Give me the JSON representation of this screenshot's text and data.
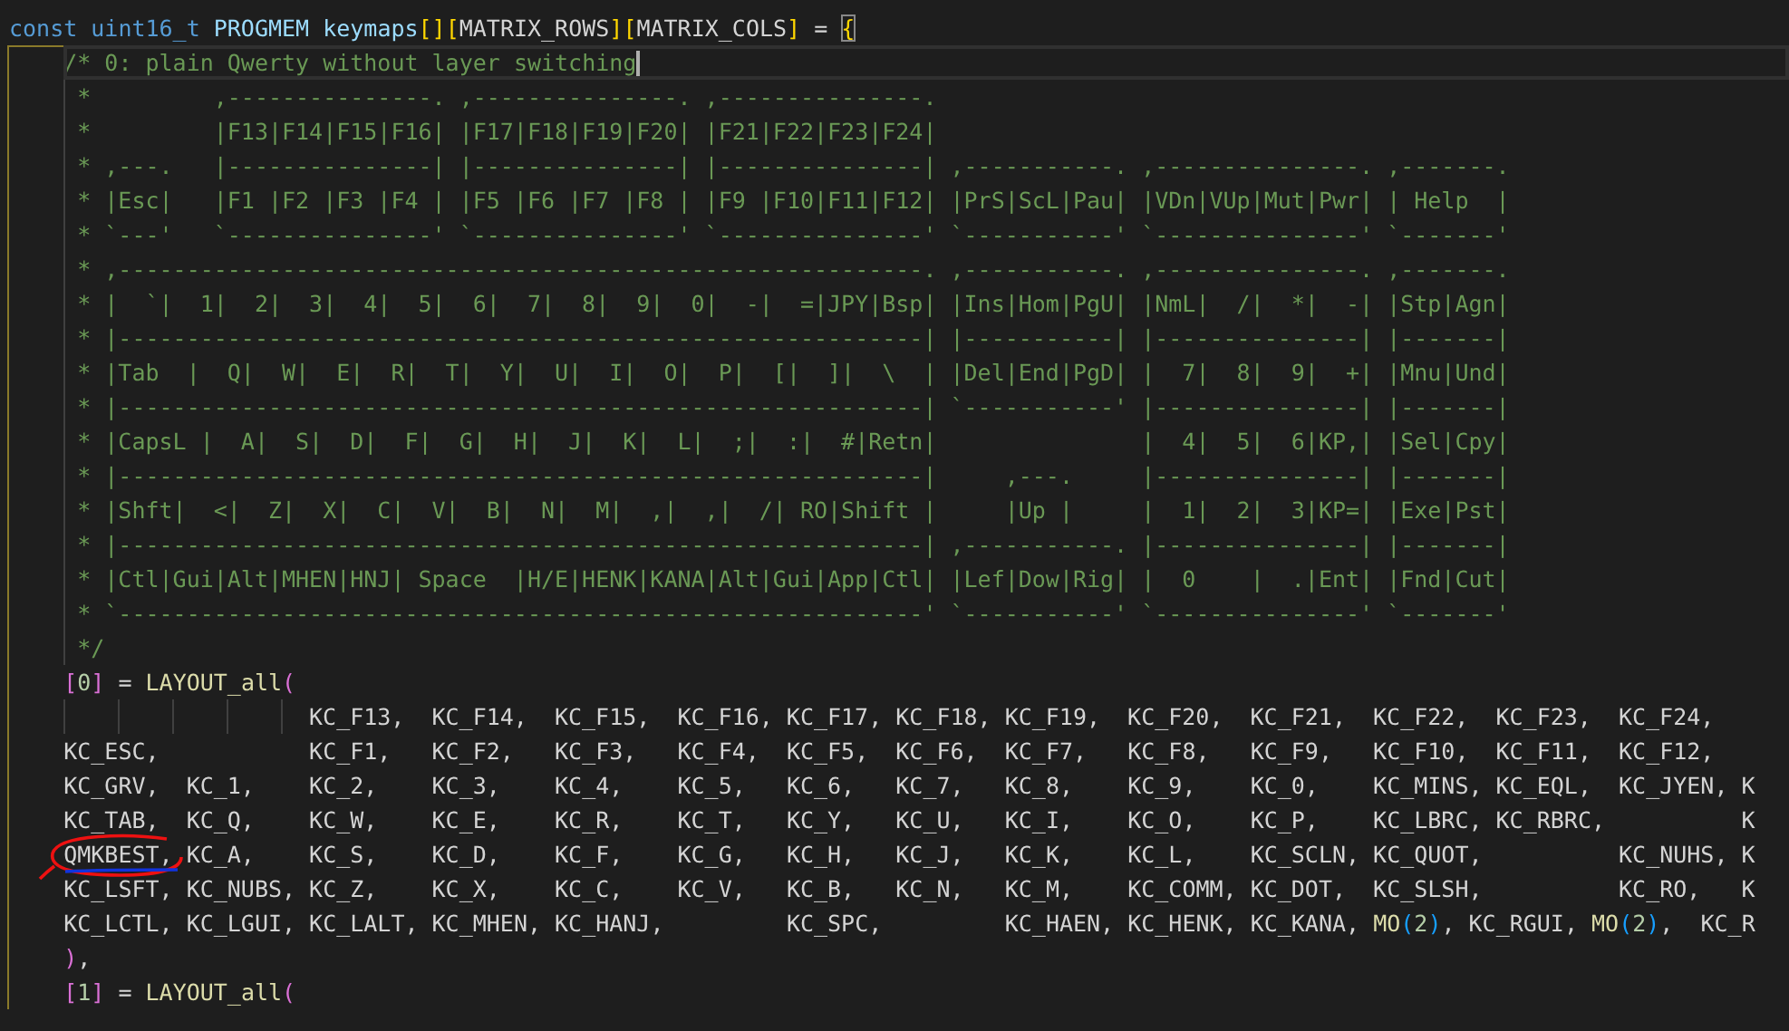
{
  "editor": {
    "lines": [
      {
        "kind": "top",
        "tokens": [
          {
            "text": "const uint16_t",
            "kind": "keyword"
          },
          {
            "text": " PROGMEM keymaps",
            "kind": "variable"
          },
          {
            "text": "[]",
            "kind": "bracket1"
          },
          {
            "text": "[",
            "kind": "bracket1"
          },
          {
            "text": "MATRIX_ROWS",
            "kind": "plain"
          },
          {
            "text": "]",
            "kind": "bracket1"
          },
          {
            "text": "[",
            "kind": "bracket1"
          },
          {
            "text": "MATRIX_COLS",
            "kind": "plain"
          },
          {
            "text": "]",
            "kind": "bracket1"
          },
          {
            "text": " = ",
            "kind": "plain"
          },
          {
            "text": "{",
            "kind": "bracket1",
            "matched": true
          }
        ]
      },
      {
        "kind": "stmt",
        "current": true,
        "tokens": [
          {
            "text": "/* 0: plain Qwerty without layer switching",
            "kind": "comment"
          }
        ]
      },
      {
        "kind": "star",
        "tokens": [
          {
            "text": "*         ,---------------. ,---------------. ,---------------.",
            "kind": "comment"
          }
        ]
      },
      {
        "kind": "star",
        "tokens": [
          {
            "text": "*         |F13|F14|F15|F16| |F17|F18|F19|F20| |F21|F22|F23|F24|",
            "kind": "comment"
          }
        ]
      },
      {
        "kind": "star",
        "tokens": [
          {
            "text": "* ,---.   |---------------| |---------------| |---------------| ,-----------. ,---------------. ,-------.",
            "kind": "comment"
          }
        ]
      },
      {
        "kind": "star",
        "tokens": [
          {
            "text": "* |Esc|   |F1 |F2 |F3 |F4 | |F5 |F6 |F7 |F8 | |F9 |F10|F11|F12| |PrS|ScL|Pau| |VDn|VUp|Mut|Pwr| | Help  |",
            "kind": "comment"
          }
        ]
      },
      {
        "kind": "star",
        "tokens": [
          {
            "text": "* `---'   `---------------' `---------------' `---------------' `-----------' `---------------' `-------'",
            "kind": "comment"
          }
        ]
      },
      {
        "kind": "star",
        "tokens": [
          {
            "text": "* ,-----------------------------------------------------------. ,-----------. ,---------------. ,-------.",
            "kind": "comment"
          }
        ]
      },
      {
        "kind": "star",
        "tokens": [
          {
            "text": "* |  `|  1|  2|  3|  4|  5|  6|  7|  8|  9|  0|  -|  =|JPY|Bsp| |Ins|Hom|PgU| |NmL|  /|  *|  -| |Stp|Agn|",
            "kind": "comment"
          }
        ]
      },
      {
        "kind": "star",
        "tokens": [
          {
            "text": "* |-----------------------------------------------------------| |-----------| |---------------| |-------|",
            "kind": "comment"
          }
        ]
      },
      {
        "kind": "star",
        "tokens": [
          {
            "text": "* |Tab  |  Q|  W|  E|  R|  T|  Y|  U|  I|  O|  P|  [|  ]|  \\  | |Del|End|PgD| |  7|  8|  9|  +| |Mnu|Und|",
            "kind": "comment"
          }
        ]
      },
      {
        "kind": "star",
        "tokens": [
          {
            "text": "* |-----------------------------------------------------------| `-----------' |---------------| |-------|",
            "kind": "comment"
          }
        ]
      },
      {
        "kind": "star",
        "tokens": [
          {
            "text": "* |CapsL |  A|  S|  D|  F|  G|  H|  J|  K|  L|  ;|  :|  #|Retn|               |  4|  5|  6|KP,| |Sel|Cpy|",
            "kind": "comment"
          }
        ]
      },
      {
        "kind": "star",
        "tokens": [
          {
            "text": "* |-----------------------------------------------------------|     ,---.     |---------------| |-------|",
            "kind": "comment"
          }
        ]
      },
      {
        "kind": "star",
        "tokens": [
          {
            "text": "* |Shft|  <|  Z|  X|  C|  V|  B|  N|  M|  ,|  ,|  /| RO|Shift |     |Up |     |  1|  2|  3|KP=| |Exe|Pst|",
            "kind": "comment"
          }
        ]
      },
      {
        "kind": "star",
        "tokens": [
          {
            "text": "* |-----------------------------------------------------------| ,-----------. |---------------| |-------|",
            "kind": "comment"
          }
        ]
      },
      {
        "kind": "star",
        "tokens": [
          {
            "text": "* |Ctl|Gui|Alt|MHEN|HNJ| Space  |H/E|HENK|KANA|Alt|Gui|App|Ctl| |Lef|Dow|Rig| |  0    |  .|Ent| |Fnd|Cut|",
            "kind": "comment"
          }
        ]
      },
      {
        "kind": "star",
        "tokens": [
          {
            "text": "* `-----------------------------------------------------------' `-----------' `---------------' `-------'",
            "kind": "comment"
          }
        ]
      },
      {
        "kind": "star",
        "tokens": [
          {
            "text": "*/",
            "kind": "comment"
          }
        ]
      },
      {
        "kind": "stmt",
        "tokens": [
          {
            "text": "[",
            "kind": "bracket2"
          },
          {
            "text": "0",
            "kind": "number"
          },
          {
            "text": "]",
            "kind": "bracket2"
          },
          {
            "text": " = ",
            "kind": "plain"
          },
          {
            "text": "LAYOUT_all",
            "kind": "function"
          },
          {
            "text": "(",
            "kind": "bracket2"
          }
        ]
      },
      {
        "kind": "gap",
        "tokens": [
          {
            "text": "KC_F13,  KC_F14,  KC_F15,  KC_F16, KC_F17, KC_F18, KC_F19,  KC_F20,  KC_F21,  KC_F22,  KC_F23,  KC_F24,",
            "kind": "plain"
          }
        ]
      },
      {
        "kind": "stmt",
        "tokens": [
          {
            "text": "KC_ESC,           KC_F1,   KC_F2,   KC_F3,   KC_F4,  KC_F5,  KC_F6,  KC_F7,   KC_F8,   KC_F9,   KC_F10,  KC_F11,  KC_F12,",
            "kind": "plain"
          }
        ]
      },
      {
        "kind": "stmt",
        "tokens": [
          {
            "text": "KC_GRV,  KC_1,    KC_2,    KC_3,    KC_4,    KC_5,   KC_6,   KC_7,   KC_8,    KC_9,    KC_0,    KC_MINS, KC_EQL,  KC_JYEN, K",
            "kind": "plain"
          }
        ]
      },
      {
        "kind": "stmt",
        "tokens": [
          {
            "text": "KC_TAB,  KC_Q,    KC_W,    KC_E,    KC_R,    KC_T,   KC_Y,   KC_U,   KC_I,    KC_O,    KC_P,    KC_LBRC, KC_RBRC,          K",
            "kind": "plain"
          }
        ]
      },
      {
        "kind": "stmt",
        "tokens": [
          {
            "text": "QMKBEST, KC_A,    KC_S,    KC_D,    KC_F,    KC_G,   KC_H,   KC_J,   KC_K,    KC_L,    KC_SCLN, KC_QUOT,          KC_NUHS, K",
            "kind": "plain"
          }
        ]
      },
      {
        "kind": "stmt",
        "tokens": [
          {
            "text": "KC_LSFT, KC_NUBS, KC_Z,    KC_X,    KC_C,    KC_V,   KC_B,   KC_N,   KC_M,    KC_COMM, KC_DOT,  KC_SLSH,          KC_RO,   K",
            "kind": "plain"
          }
        ]
      },
      {
        "kind": "stmt",
        "tokens": [
          {
            "text": "KC_LCTL, KC_LGUI, KC_LALT, KC_MHEN, KC_HANJ,         KC_SPC,         KC_HAEN, KC_HENK, KC_KANA, ",
            "kind": "plain"
          },
          {
            "text": "MO",
            "kind": "function"
          },
          {
            "text": "(",
            "kind": "bracket3"
          },
          {
            "text": "2",
            "kind": "number"
          },
          {
            "text": ")",
            "kind": "bracket3"
          },
          {
            "text": ", KC_RGUI, ",
            "kind": "plain"
          },
          {
            "text": "MO",
            "kind": "function"
          },
          {
            "text": "(",
            "kind": "bracket3"
          },
          {
            "text": "2",
            "kind": "number"
          },
          {
            "text": ")",
            "kind": "bracket3"
          },
          {
            "text": ",  KC_R",
            "kind": "plain"
          }
        ]
      },
      {
        "kind": "stmt",
        "tokens": [
          {
            "text": ")",
            "kind": "bracket2"
          },
          {
            "text": ",",
            "kind": "plain"
          }
        ]
      },
      {
        "kind": "stmt",
        "tokens": [
          {
            "text": "[",
            "kind": "bracket2"
          },
          {
            "text": "1",
            "kind": "number"
          },
          {
            "text": "]",
            "kind": "bracket2"
          },
          {
            "text": " = ",
            "kind": "plain"
          },
          {
            "text": "LAYOUT_all",
            "kind": "function"
          },
          {
            "text": "(",
            "kind": "bracket2"
          }
        ]
      }
    ]
  },
  "annotations": [
    {
      "kind": "ellipse",
      "color": "#ee1111"
    },
    {
      "kind": "underline",
      "color": "#1133dd"
    }
  ]
}
